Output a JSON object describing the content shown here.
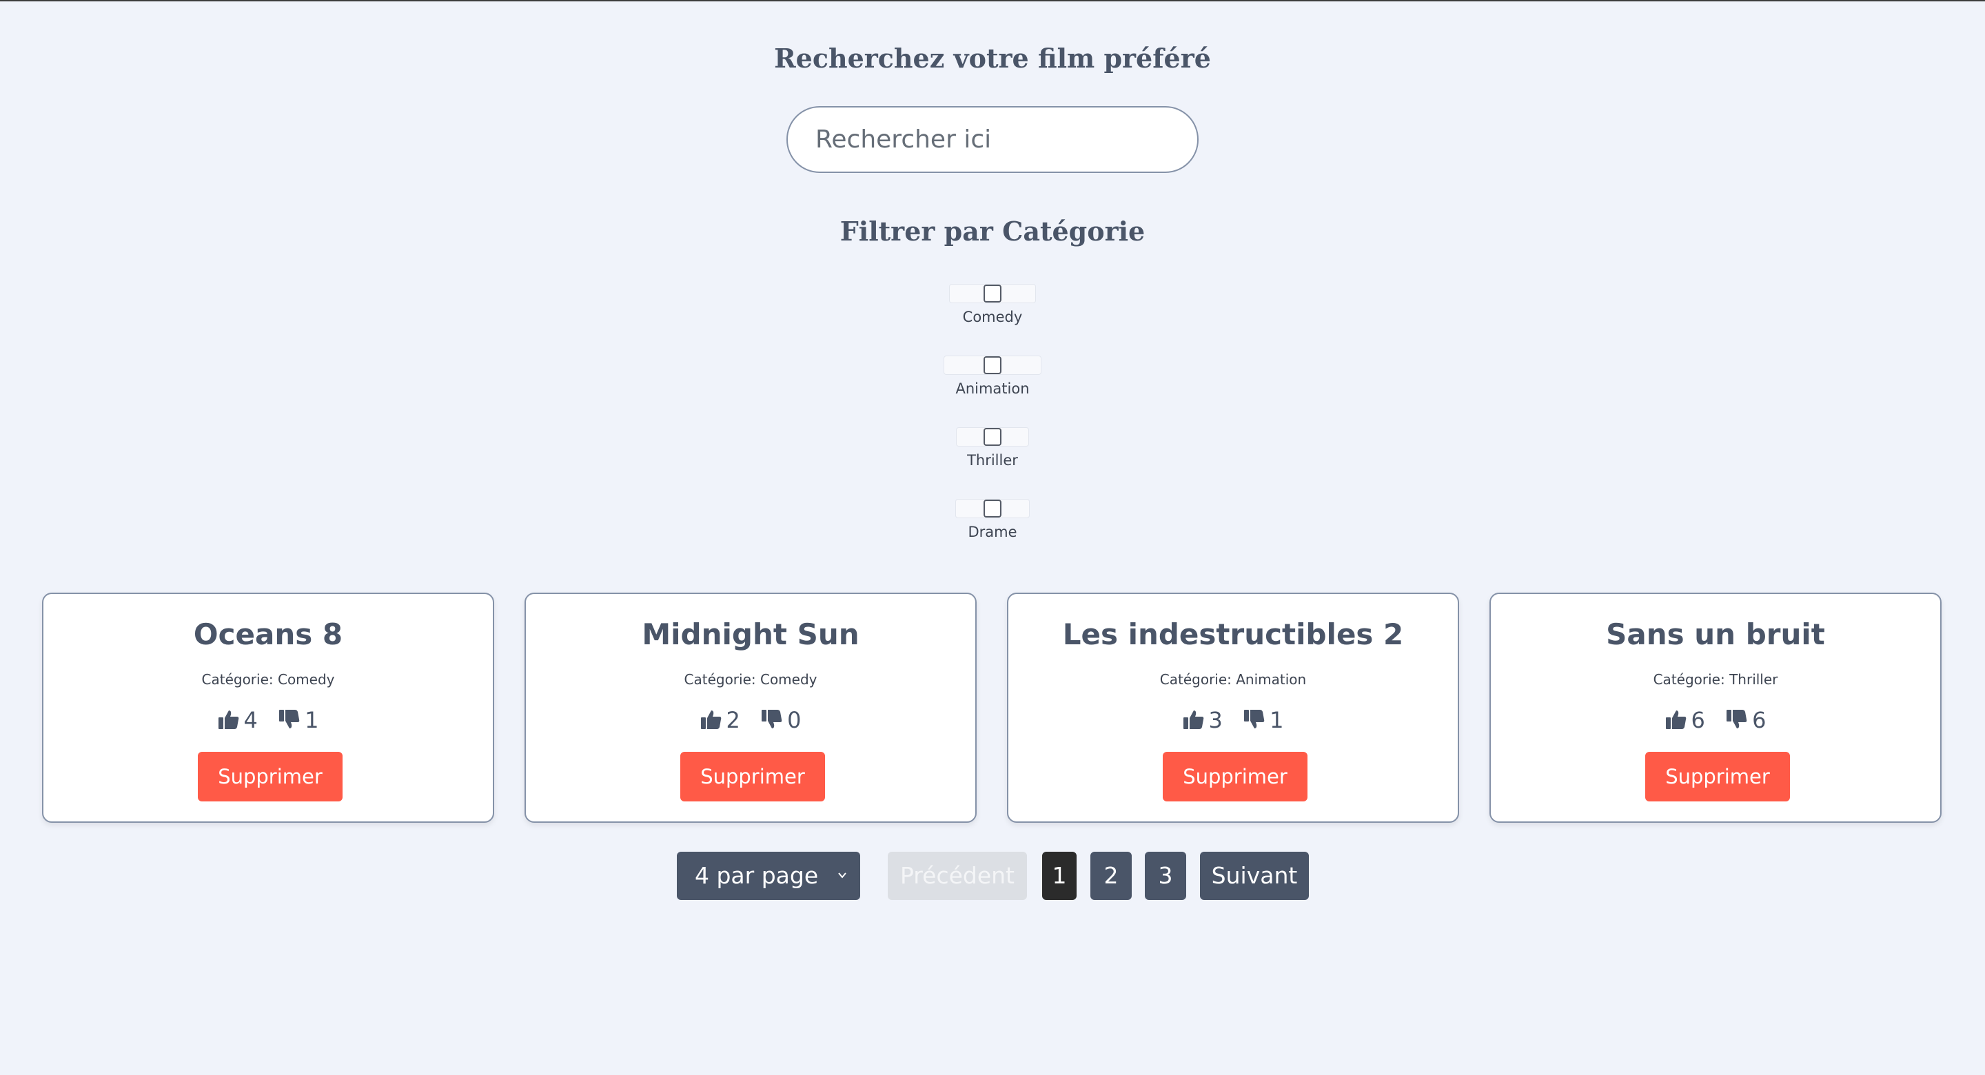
{
  "search": {
    "title": "Recherchez votre film préféré",
    "placeholder": "Rechercher ici",
    "value": ""
  },
  "filter": {
    "title": "Filtrer par Catégorie",
    "categories": [
      {
        "label": "Comedy",
        "checked": false
      },
      {
        "label": "Animation",
        "checked": false
      },
      {
        "label": "Thriller",
        "checked": false
      },
      {
        "label": "Drame",
        "checked": false
      }
    ]
  },
  "movies": [
    {
      "title": "Oceans 8",
      "category": "Catégorie: Comedy",
      "likes": "4",
      "dislikes": "1",
      "delete_label": "Supprimer"
    },
    {
      "title": "Midnight Sun",
      "category": "Catégorie: Comedy",
      "likes": "2",
      "dislikes": "0",
      "delete_label": "Supprimer"
    },
    {
      "title": "Les indestructibles 2",
      "category": "Catégorie: Animation",
      "likes": "3",
      "dislikes": "1",
      "delete_label": "Supprimer"
    },
    {
      "title": "Sans un bruit",
      "category": "Catégorie: Thriller",
      "likes": "6",
      "dislikes": "6",
      "delete_label": "Supprimer"
    }
  ],
  "pagination": {
    "per_page_label": "4 par page",
    "prev_label": "Précédent",
    "pages": [
      "1",
      "2",
      "3"
    ],
    "current_page": "1",
    "next_label": "Suivant"
  },
  "colors": {
    "background": "#f0f3fa",
    "primary": "#4a5568",
    "danger": "#ff5a47",
    "active_page": "#2b2b2b",
    "disabled": "#dcdfe4"
  },
  "icons": {
    "like": "thumbs-up-icon",
    "dislike": "thumbs-down-icon",
    "select": "chevron-down-icon"
  }
}
